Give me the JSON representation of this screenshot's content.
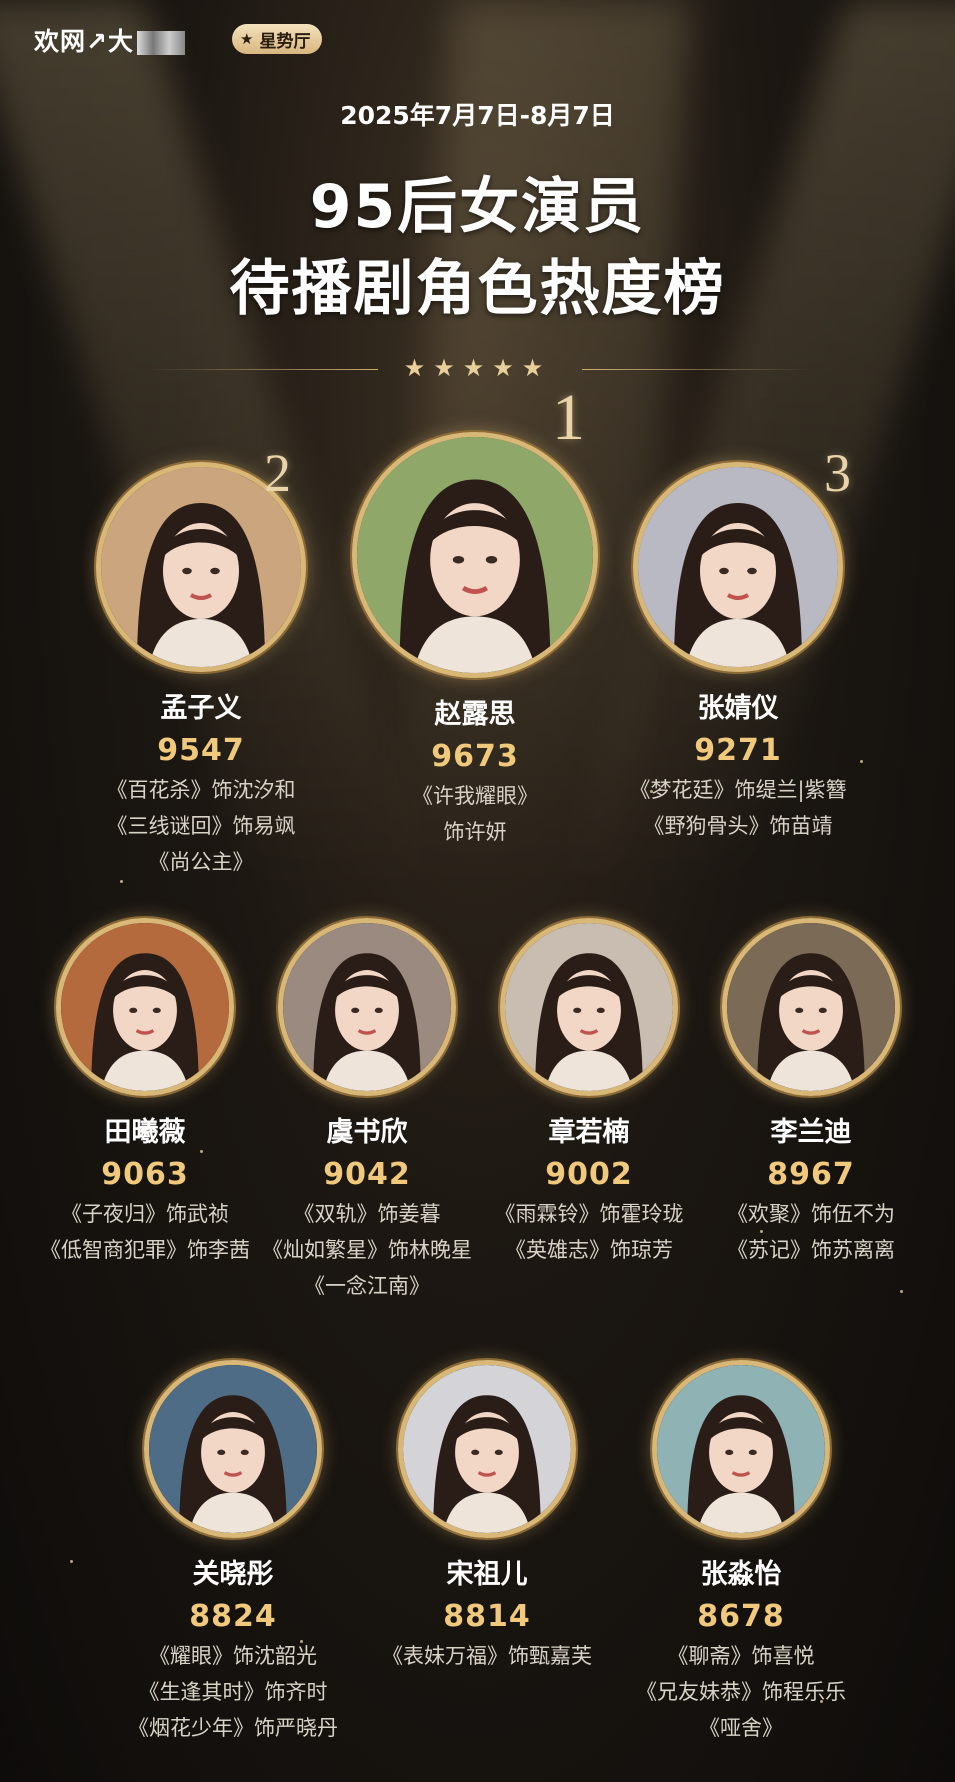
{
  "header": {
    "brand": "欢网",
    "brand_glyph": "↗大",
    "tag_label": "星势厅",
    "tag_icon": "star-icon"
  },
  "date_range": "2025年7月7日-8月7日",
  "title": {
    "line1": "95后女演员",
    "line2": "待播剧角色热度榜"
  },
  "stars": "★★★★★",
  "colors": {
    "gold": "#d9b777",
    "score": "#f0c97c",
    "background": "#1c1712"
  },
  "top3": [
    {
      "rank": "2",
      "name": "孟子义",
      "score": "9547",
      "roles": [
        "《百花杀》饰沈汐和",
        "《三线谜回》饰易飒",
        "《尚公主》"
      ]
    },
    {
      "rank": "1",
      "name": "赵露思",
      "score": "9673",
      "roles": [
        "《许我耀眼》",
        "饰许妍"
      ]
    },
    {
      "rank": "3",
      "name": "张婧仪",
      "score": "9271",
      "roles": [
        "《梦花廷》饰缇兰|紫簪",
        "《野狗骨头》饰苗靖"
      ]
    }
  ],
  "row2": [
    {
      "name": "田曦薇",
      "score": "9063",
      "roles": [
        "《子夜归》饰武祯",
        "《低智商犯罪》饰李茜"
      ]
    },
    {
      "name": "虞书欣",
      "score": "9042",
      "roles": [
        "《双轨》饰姜暮",
        "《灿如繁星》饰林晚星",
        "《一念江南》"
      ]
    },
    {
      "name": "章若楠",
      "score": "9002",
      "roles": [
        "《雨霖铃》饰霍玲珑",
        "《英雄志》饰琼芳"
      ]
    },
    {
      "name": "李兰迪",
      "score": "8967",
      "roles": [
        "《欢聚》饰伍不为",
        "《苏记》饰苏离离"
      ]
    }
  ],
  "row3": [
    {
      "name": "关晓彤",
      "score": "8824",
      "roles": [
        "《耀眼》饰沈韶光",
        "《生逢其时》饰齐时",
        "《烟花少年》饰严晓丹"
      ]
    },
    {
      "name": "宋祖儿",
      "score": "8814",
      "roles": [
        "《表妹万福》饰甄嘉芙"
      ]
    },
    {
      "name": "张淼怡",
      "score": "8678",
      "roles": [
        "《聊斋》饰喜悦",
        "《兄友妹恭》饰程乐乐",
        "《哑舍》"
      ]
    }
  ]
}
